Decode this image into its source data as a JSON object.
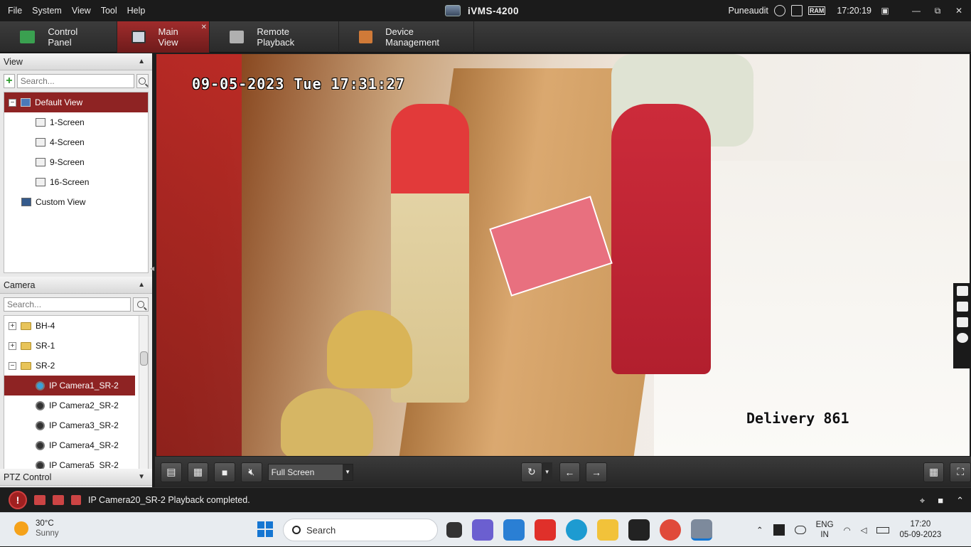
{
  "menu": [
    "File",
    "System",
    "View",
    "Tool",
    "Help"
  ],
  "app_title": "iVMS-4200",
  "title_right": {
    "user": "Puneaudit",
    "ram": "RAM",
    "time": "17:20:19"
  },
  "tabs": [
    {
      "label": "Control Panel",
      "color": "#3aa050"
    },
    {
      "label": "Main View",
      "color": "#cfd6e0"
    },
    {
      "label": "Remote Playback",
      "color": "#b0b0b0"
    },
    {
      "label": "Device Management",
      "color": "#d07a38"
    }
  ],
  "view_panel": {
    "header": "View",
    "search_placeholder": "Search...",
    "items": [
      {
        "label": "Default View"
      },
      {
        "label": "1-Screen"
      },
      {
        "label": "4-Screen"
      },
      {
        "label": "9-Screen"
      },
      {
        "label": "16-Screen"
      },
      {
        "label": "Custom View"
      }
    ]
  },
  "camera_panel": {
    "header": "Camera",
    "search_placeholder": "Search...",
    "groups": [
      {
        "label": "BH-4"
      },
      {
        "label": "SR-1"
      },
      {
        "label": "SR-2"
      }
    ],
    "cameras": [
      {
        "label": "IP Camera1_SR-2"
      },
      {
        "label": "IP Camera2_SR-2"
      },
      {
        "label": "IP Camera3_SR-2"
      },
      {
        "label": "IP Camera4_SR-2"
      },
      {
        "label": "IP Camera5_SR-2"
      }
    ]
  },
  "ptz_header": "PTZ Control",
  "video": {
    "osd_time": "09-05-2023 Tue 17:31:27",
    "osd_name": "Delivery 861"
  },
  "toolbar": {
    "screen_mode": "Full Screen"
  },
  "status": {
    "message": "IP Camera20_SR-2 Playback completed."
  },
  "taskbar": {
    "temp": "30°C",
    "weather": "Sunny",
    "search": "Search",
    "lang_top": "ENG",
    "lang_bottom": "IN",
    "time": "17:20",
    "date": "05-09-2023"
  }
}
